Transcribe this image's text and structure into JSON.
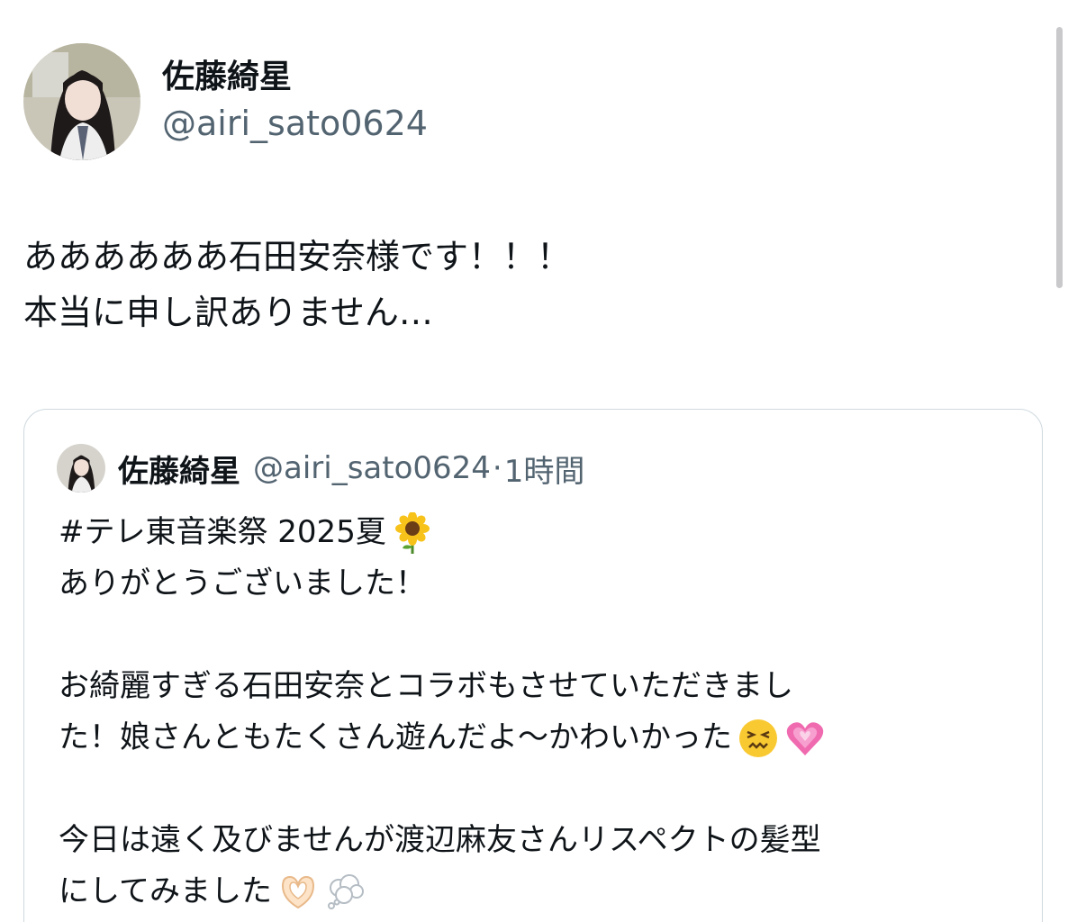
{
  "tweet": {
    "display_name": "佐藤綺星",
    "handle": "@airi_sato0624",
    "text_lines": [
      "ああああああ石田安奈様です！！！",
      "本当に申し訳ありません…"
    ]
  },
  "quote": {
    "display_name": "佐藤綺星",
    "handle": "@airi_sato0624",
    "separator": "·",
    "time": "1時間",
    "lines": [
      "#テレ東音楽祭 2025夏",
      "ありがとうございました！",
      "",
      "お綺麗すぎる石田安奈とコラボもさせていただきまし",
      "た！娘さんともたくさん遊んだよ〜かわいかった",
      "",
      "今日は遠く及びませんが渡辺麻友さんリスペクトの髪型",
      "にしてみました"
    ],
    "emojis": {
      "line0": "sunflower-emoji",
      "line4": [
        "confounded-face-emoji",
        "growing-heart-emoji"
      ],
      "line7": [
        "heart-hands-emoji",
        "thought-balloon-emoji"
      ]
    }
  },
  "colors": {
    "text": "#0f1419",
    "secondary": "#536471",
    "border": "#cfd9de"
  }
}
